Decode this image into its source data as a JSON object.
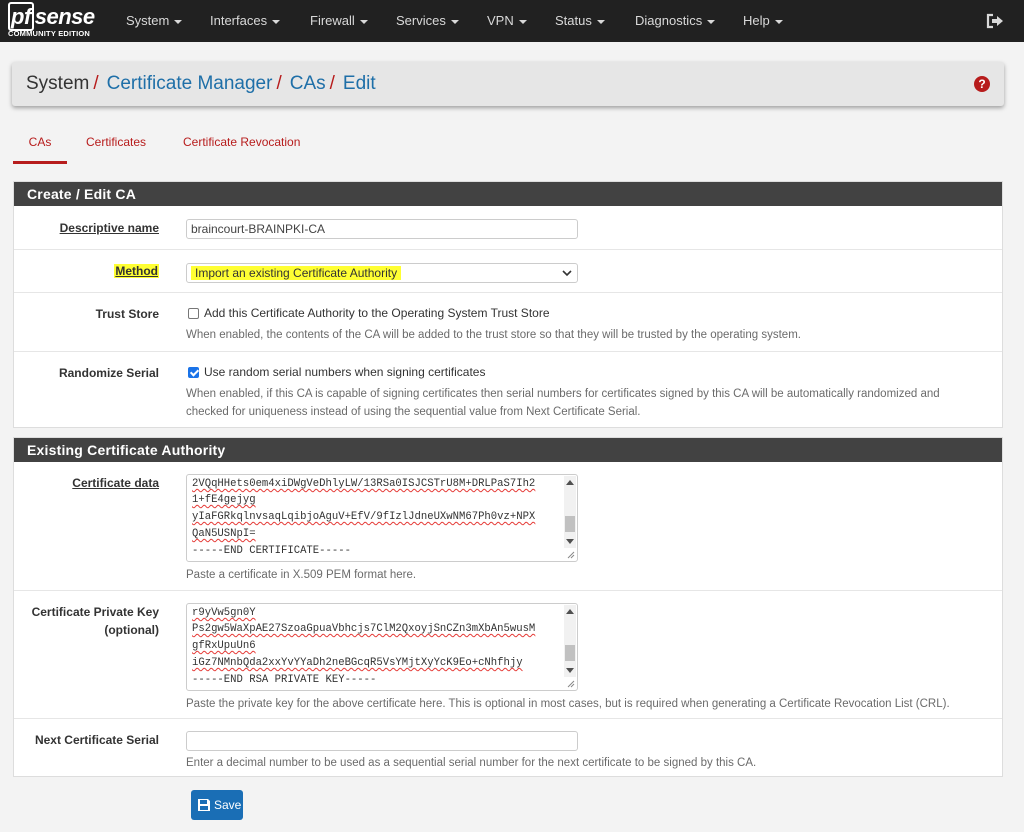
{
  "brand": {
    "name_prefix": "pf",
    "name_suffix": "sense",
    "edition": "COMMUNITY EDITION"
  },
  "nav": {
    "items": [
      {
        "label": "System"
      },
      {
        "label": "Interfaces"
      },
      {
        "label": "Firewall"
      },
      {
        "label": "Services"
      },
      {
        "label": "VPN"
      },
      {
        "label": "Status"
      },
      {
        "label": "Diagnostics"
      },
      {
        "label": "Help"
      }
    ],
    "logout_icon": "sign-out-icon"
  },
  "breadcrumb": {
    "root": "System",
    "items": [
      "Certificate Manager",
      "CAs",
      "Edit"
    ],
    "separator": "/"
  },
  "tabs": [
    {
      "label": "CAs",
      "active": true
    },
    {
      "label": "Certificates"
    },
    {
      "label": "Certificate Revocation"
    }
  ],
  "create_panel": {
    "title": "Create / Edit CA",
    "descriptive_name": {
      "label": "Descriptive name",
      "value": "braincourt-BRAINPKI-CA"
    },
    "method": {
      "label": "Method",
      "value": "Import an existing Certificate Authority"
    },
    "trust_store": {
      "label": "Trust Store",
      "checkbox_label": "Add this Certificate Authority to the Operating System Trust Store",
      "checked": false,
      "help": "When enabled, the contents of the CA will be added to the trust store so that they will be trusted by the operating system."
    },
    "randomize_serial": {
      "label": "Randomize Serial",
      "checkbox_label": "Use random serial numbers when signing certificates",
      "checked": true,
      "help_line1": "When enabled, if this CA is capable of signing certificates then serial numbers for certificates signed by this CA will be automatically randomized and",
      "help_line2": "checked for uniqueness instead of using the sequential value from Next Certificate Serial."
    }
  },
  "existing_panel": {
    "title": "Existing Certificate Authority",
    "cert_data": {
      "label": "Certificate data",
      "lines": [
        "2VQqHHets0em4xiDWgVeDhlyLW/13RSa0ISJCSTrU8M+DRLPaS7Ih2",
        "1+fE4gejyg",
        "yIaFGRkqlnvsaqLqibjoAguV+EfV/9fIzlJdneUXwNM67Ph0vz+NPX",
        "QaN5USNpI=",
        "-----END CERTIFICATE-----"
      ],
      "help": "Paste a certificate in X.509 PEM format here."
    },
    "private_key": {
      "label_line1": "Certificate Private Key",
      "label_line2": "(optional)",
      "lines": [
        "r9yVw5gn0Y",
        "Ps2gw5WaXpAE27SzoaGpuaVbhcjs7ClM2QxoyjSnCZn3mXbAn5wusM",
        "gfRxUpuUn6",
        "iGz7NMnbQda2xxYvYYaDh2neBGcqR5VsYMjtXyYcK9Eo+cNhfhjy",
        "-----END RSA PRIVATE KEY-----"
      ],
      "help": "Paste the private key for the above certificate here. This is optional in most cases, but is required when generating a Certificate Revocation List (CRL)."
    },
    "next_serial": {
      "label": "Next Certificate Serial",
      "value": "",
      "help": "Enter a decimal number to be used as a sequential serial number for the next certificate to be signed by this CA."
    }
  },
  "save_button": {
    "label": "Save"
  },
  "colors": {
    "navbar": "#212121",
    "accent": "#b71c1c",
    "link": "#1e6fa8",
    "panel_head": "#424242",
    "button": "#1a6eb5",
    "highlight": "#ffff33"
  }
}
